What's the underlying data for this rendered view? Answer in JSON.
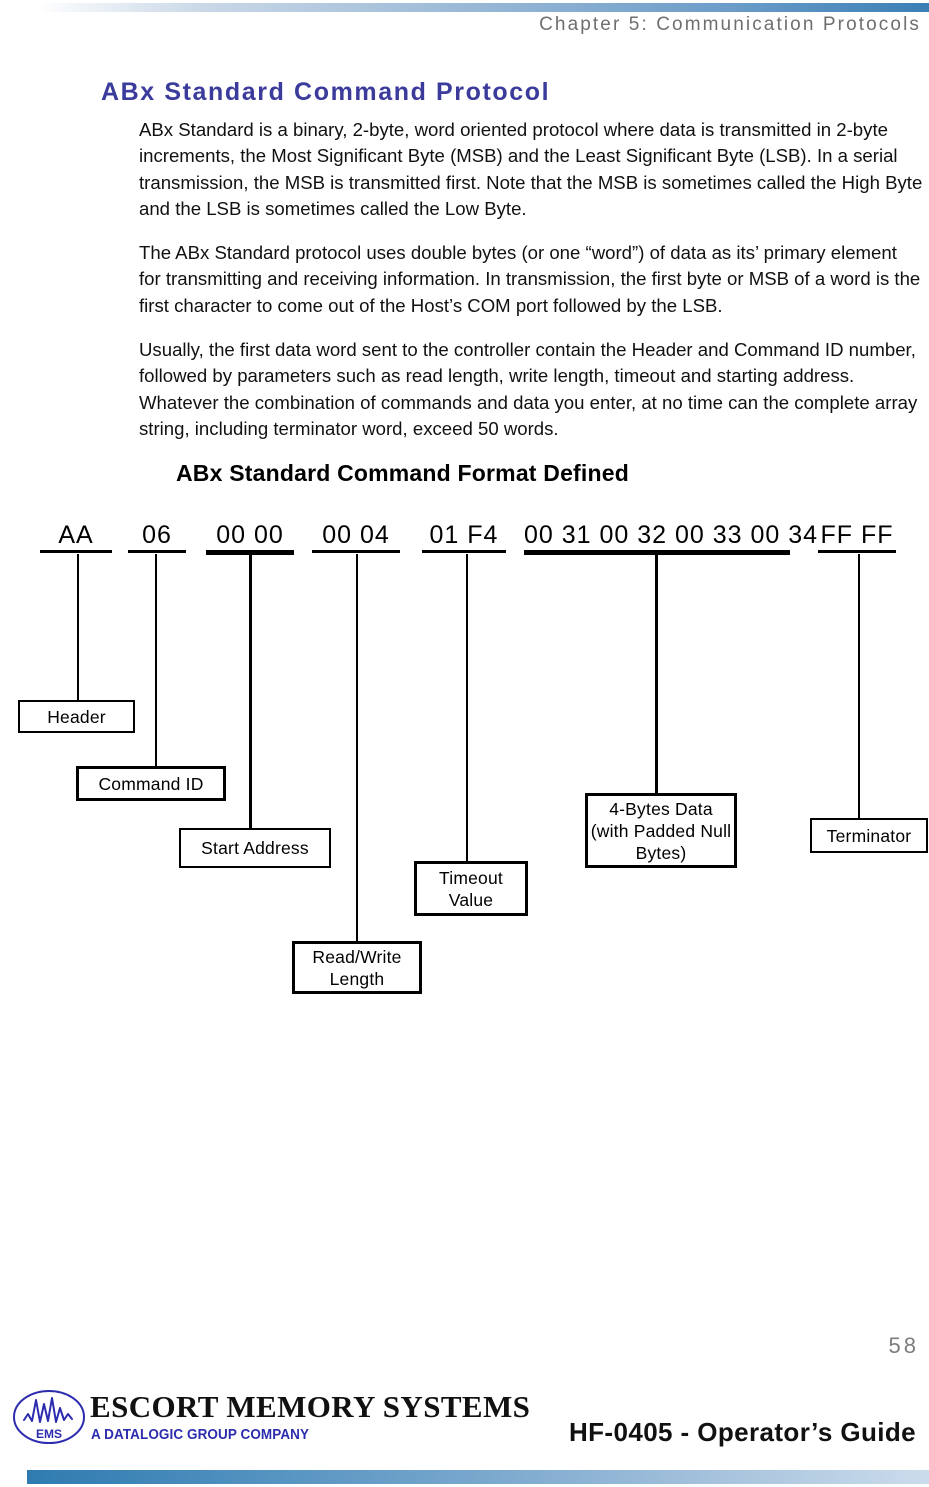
{
  "header": {
    "chapter": "Chapter 5: Communication Protocols"
  },
  "page_title": "ABx Standard Command Protocol",
  "paragraphs": [
    "ABx Standard is a binary, 2-byte, word oriented protocol where data is transmitted in 2-byte increments, the Most Significant Byte (MSB) and the Least Significant Byte (LSB). In a serial transmission, the MSB is transmitted first. Note that the MSB is sometimes called the High Byte and the LSB is sometimes called the Low Byte.",
    "The ABx Standard protocol uses double bytes (or one “word”) of data as its’ primary element for transmitting and receiving information. In transmission, the first byte or MSB of a word is the first character to come out of the Host’s COM port followed by the LSB.",
    "Usually, the first data word sent to the controller contain the Header and Command ID number, followed by parameters such as read length, write length, timeout and starting address. Whatever the combination of commands and data you enter, at no time can the complete array string, including terminator word, exceed 50 words."
  ],
  "diagram": {
    "title": "ABx Standard Command Format Defined",
    "fields": [
      {
        "hex": "AA",
        "label": "Header"
      },
      {
        "hex": "06",
        "label": "Command ID"
      },
      {
        "hex": "00 00",
        "label": "Start Address"
      },
      {
        "hex": "00 04",
        "label": "Read/Write Length"
      },
      {
        "hex": "01 F4",
        "label": "Timeout Value"
      },
      {
        "hex": "00 31 00 32 00 33 00 34",
        "label": "4-Bytes Data (with Padded Null Bytes)"
      },
      {
        "hex": "FF FF",
        "label": "Terminator"
      }
    ],
    "label_lines": {
      "read_write_length": [
        "Read/Write",
        "Length"
      ],
      "timeout_value": [
        "Timeout",
        "Value"
      ],
      "four_bytes_data": [
        "4-Bytes Data",
        "(with Padded Null",
        "Bytes)"
      ]
    }
  },
  "footer": {
    "page_number": "58",
    "logo_mark_text": "EMS",
    "company_name": "ESCORT MEMORY SYSTEMS",
    "company_tagline": "A DATALOGIC GROUP COMPANY",
    "guide_title": "HF-0405 - Operator’s Guide"
  },
  "colors": {
    "title_blue": "#3b3b9c",
    "header_gray": "#6f6f6f",
    "accent_bar_blue": "#3b7fb5",
    "logo_blue": "#2c2cae"
  }
}
